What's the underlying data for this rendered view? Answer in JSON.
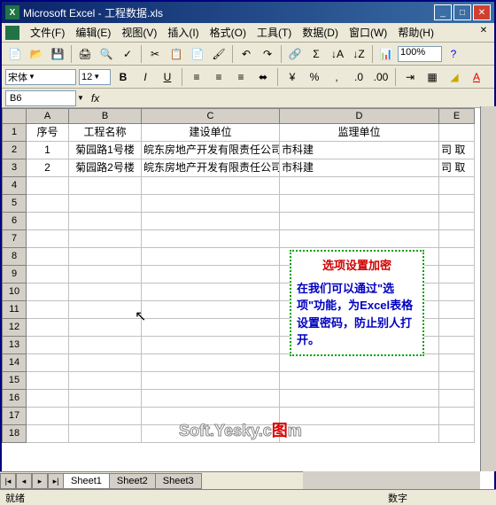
{
  "window": {
    "title": "Microsoft Excel - 工程数据.xls"
  },
  "menus": {
    "file": "文件(F)",
    "edit": "编辑(E)",
    "view": "视图(V)",
    "insert": "插入(I)",
    "format": "格式(O)",
    "tools": "工具(T)",
    "data": "数据(D)",
    "window": "窗口(W)",
    "help": "帮助(H)"
  },
  "toolbar": {
    "zoom": "100%"
  },
  "format": {
    "font": "宋体",
    "size": "12"
  },
  "formula": {
    "namebox": "B6",
    "fx": "fx"
  },
  "columns": {
    "A": "A",
    "B": "B",
    "C": "C",
    "D": "D",
    "E": "E"
  },
  "headers": {
    "A": "序号",
    "B": "工程名称",
    "C": "建设单位",
    "D": "监理单位"
  },
  "rows": [
    {
      "num": "1",
      "A": "1",
      "B": "菊园路1号楼",
      "C": "皖东房地产开发有限责任公司",
      "D": "市科建",
      "E": "司 取"
    },
    {
      "num": "2",
      "A": "2",
      "B": "菊园路2号楼",
      "C": "皖东房地产开发有限责任公司",
      "D": "市科建",
      "E": "司 取"
    }
  ],
  "callout": {
    "title": "选项设置加密",
    "body": "在我们可以通过\"选项\"功能，为Excel表格设置密码，防止别人打开。"
  },
  "watermark": {
    "text1": "Soft.Yesky.c",
    "text2": "m"
  },
  "sheets": {
    "s1": "Sheet1",
    "s2": "Sheet2",
    "s3": "Sheet3"
  },
  "status": {
    "ready": "就绪",
    "mode": "数字"
  }
}
